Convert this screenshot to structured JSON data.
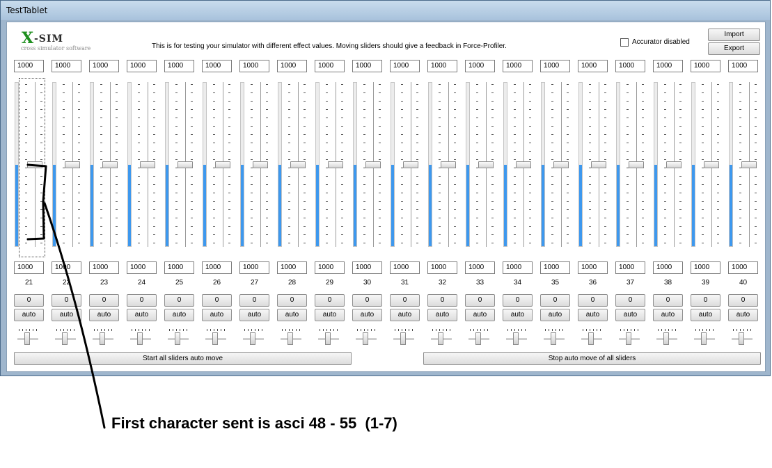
{
  "window": {
    "title": "TestTablet"
  },
  "header": {
    "logo_mark": "X",
    "logo_text": "-SIM",
    "logo_subtitle": "cross simulator software",
    "description": "This is for testing your simulator with different effect values. Moving sliders should give a feedback in Force-Profiler.",
    "accurator_label": "Accurator disabled",
    "accurator_checked": false,
    "import_label": "Import",
    "export_label": "Export"
  },
  "sliders": {
    "fill_color": "#3d98ee",
    "level_fraction": 0.5,
    "channels": [
      {
        "number": "21",
        "top_value": "1000",
        "bottom_value": "1000",
        "zero_label": "0",
        "auto_label": "auto"
      },
      {
        "number": "22",
        "top_value": "1000",
        "bottom_value": "1000",
        "zero_label": "0",
        "auto_label": "auto"
      },
      {
        "number": "23",
        "top_value": "1000",
        "bottom_value": "1000",
        "zero_label": "0",
        "auto_label": "auto"
      },
      {
        "number": "24",
        "top_value": "1000",
        "bottom_value": "1000",
        "zero_label": "0",
        "auto_label": "auto"
      },
      {
        "number": "25",
        "top_value": "1000",
        "bottom_value": "1000",
        "zero_label": "0",
        "auto_label": "auto"
      },
      {
        "number": "26",
        "top_value": "1000",
        "bottom_value": "1000",
        "zero_label": "0",
        "auto_label": "auto"
      },
      {
        "number": "27",
        "top_value": "1000",
        "bottom_value": "1000",
        "zero_label": "0",
        "auto_label": "auto"
      },
      {
        "number": "28",
        "top_value": "1000",
        "bottom_value": "1000",
        "zero_label": "0",
        "auto_label": "auto"
      },
      {
        "number": "29",
        "top_value": "1000",
        "bottom_value": "1000",
        "zero_label": "0",
        "auto_label": "auto"
      },
      {
        "number": "30",
        "top_value": "1000",
        "bottom_value": "1000",
        "zero_label": "0",
        "auto_label": "auto"
      },
      {
        "number": "31",
        "top_value": "1000",
        "bottom_value": "1000",
        "zero_label": "0",
        "auto_label": "auto"
      },
      {
        "number": "32",
        "top_value": "1000",
        "bottom_value": "1000",
        "zero_label": "0",
        "auto_label": "auto"
      },
      {
        "number": "33",
        "top_value": "1000",
        "bottom_value": "1000",
        "zero_label": "0",
        "auto_label": "auto"
      },
      {
        "number": "34",
        "top_value": "1000",
        "bottom_value": "1000",
        "zero_label": "0",
        "auto_label": "auto"
      },
      {
        "number": "35",
        "top_value": "1000",
        "bottom_value": "1000",
        "zero_label": "0",
        "auto_label": "auto"
      },
      {
        "number": "36",
        "top_value": "1000",
        "bottom_value": "1000",
        "zero_label": "0",
        "auto_label": "auto"
      },
      {
        "number": "37",
        "top_value": "1000",
        "bottom_value": "1000",
        "zero_label": "0",
        "auto_label": "auto"
      },
      {
        "number": "38",
        "top_value": "1000",
        "bottom_value": "1000",
        "zero_label": "0",
        "auto_label": "auto"
      },
      {
        "number": "39",
        "top_value": "1000",
        "bottom_value": "1000",
        "zero_label": "0",
        "auto_label": "auto"
      },
      {
        "number": "40",
        "top_value": "1000",
        "bottom_value": "1000",
        "zero_label": "0",
        "auto_label": "auto"
      }
    ]
  },
  "footer": {
    "start_label": "Start all sliders auto move",
    "stop_label": "Stop auto move of all sliders"
  },
  "annotation": {
    "text": "First character sent is asci 48 - 55  (1-7)"
  }
}
